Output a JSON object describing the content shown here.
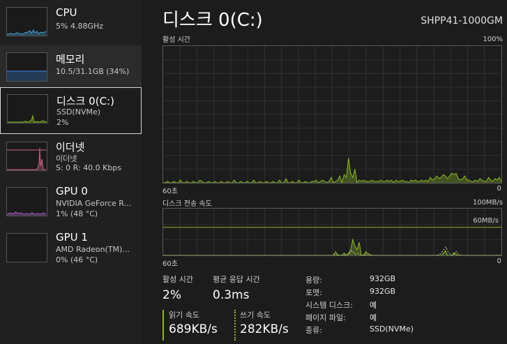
{
  "sidebar": {
    "items": [
      {
        "name": "CPU",
        "line1": "5% 4.88GHz",
        "line2": ""
      },
      {
        "name": "메모리",
        "line1": "10.5/31.1GB (34%)",
        "line2": ""
      },
      {
        "name": "디스크 0(C:)",
        "line1": "SSD(NVMe)",
        "line2": "2%"
      },
      {
        "name": "이더넷",
        "line1": "이더넷",
        "line2": "S: 0 R: 40.0 Kbps"
      },
      {
        "name": "GPU 0",
        "line1": "NVIDIA GeForce R...",
        "line2": "1% (48 °C)"
      },
      {
        "name": "GPU 1",
        "line1": "AMD Radeon(TM)...",
        "line2": "0% (46 °C)"
      }
    ]
  },
  "header": {
    "title": "디스크 0(C:)",
    "model": "SHPP41-1000GM"
  },
  "activity_chart": {
    "label": "활성 시간",
    "max_label": "100%",
    "time_label": "60초",
    "min_label": "0",
    "values": [
      0,
      0,
      1,
      0,
      0,
      1,
      0,
      0,
      2,
      0,
      0,
      1,
      0,
      0,
      1,
      0,
      0,
      2,
      1,
      0,
      0,
      1,
      0,
      0,
      1,
      0,
      0,
      1,
      0,
      0,
      1,
      0,
      0,
      2,
      0,
      0,
      1,
      0,
      0,
      1,
      0,
      0,
      2,
      0,
      0,
      1,
      0,
      0,
      1,
      0,
      0,
      1,
      0,
      0,
      2,
      0,
      0,
      3,
      0,
      0,
      1,
      0,
      0,
      2,
      0,
      0,
      1,
      0,
      0,
      1,
      1,
      2,
      0,
      1,
      2,
      1,
      0,
      1,
      4,
      0,
      1,
      2,
      5,
      0,
      6,
      4,
      18,
      7,
      4,
      10,
      0,
      2,
      1,
      2,
      1,
      1,
      1,
      2,
      1,
      1,
      1,
      2,
      1,
      1,
      2,
      1,
      2,
      0,
      2,
      1,
      1,
      2,
      1,
      1,
      0,
      2,
      1,
      2,
      1,
      1,
      2,
      1,
      2,
      1,
      4,
      2,
      3,
      5,
      3,
      4,
      6,
      5,
      3,
      5,
      7,
      6,
      7,
      3,
      2,
      3,
      5,
      2,
      2,
      1,
      1,
      2,
      1,
      3,
      2,
      1,
      1,
      4,
      2,
      1,
      3,
      2,
      4,
      1
    ]
  },
  "transfer_chart": {
    "label": "디스크 전송 속도",
    "max_label": "100MB/s",
    "ref_label": "60MB/s",
    "ref_value": 60,
    "max_value": 100,
    "time_label": "60초",
    "min_label": "0",
    "read": [
      0,
      0,
      0,
      0,
      0,
      0,
      0,
      0,
      0,
      0,
      0,
      0,
      0,
      0,
      0,
      0,
      0,
      0,
      0,
      0,
      0,
      0,
      0,
      0,
      0,
      0,
      0,
      0,
      0,
      0,
      0,
      0,
      0,
      0,
      0,
      0,
      0,
      0,
      0,
      0,
      0,
      0,
      0,
      0,
      0,
      0,
      0,
      0,
      0,
      0,
      0,
      0,
      0,
      0,
      0,
      0,
      0,
      0,
      0,
      0,
      0,
      0,
      0,
      0,
      0,
      0,
      0,
      0,
      0,
      0,
      0,
      0,
      0,
      0,
      0,
      0,
      0,
      0,
      0,
      0,
      8,
      2,
      0,
      0,
      5,
      0,
      4,
      12,
      34,
      20,
      12,
      28,
      0,
      0,
      8,
      4,
      2,
      0,
      0,
      0,
      0,
      0,
      0,
      0,
      0,
      0,
      0,
      0,
      0,
      0,
      0,
      0,
      0,
      0,
      0,
      0,
      0,
      0,
      0,
      0,
      0,
      0,
      0,
      0,
      0,
      0,
      0,
      0,
      0,
      0,
      4,
      10,
      0,
      0,
      0,
      6,
      2,
      0,
      0,
      0,
      0,
      0,
      0,
      0,
      0,
      0,
      0,
      0,
      0,
      0,
      0,
      0,
      0,
      0,
      0,
      0,
      0,
      0
    ],
    "write": [
      0,
      0,
      0,
      0,
      0,
      0,
      0,
      0,
      0,
      0,
      0,
      0,
      0,
      0,
      0,
      0,
      0,
      0,
      0,
      0,
      0,
      0,
      0,
      0,
      0,
      0,
      0,
      0,
      0,
      0,
      0,
      0,
      0,
      0,
      0,
      0,
      0,
      0,
      0,
      0,
      0,
      0,
      0,
      0,
      0,
      0,
      0,
      0,
      0,
      0,
      0,
      0,
      0,
      0,
      0,
      0,
      0,
      0,
      0,
      0,
      0,
      0,
      0,
      0,
      0,
      0,
      0,
      0,
      0,
      0,
      0,
      0,
      0,
      0,
      0,
      0,
      0,
      0,
      0,
      0,
      2,
      0,
      0,
      0,
      1,
      0,
      2,
      4,
      10,
      6,
      2,
      4,
      0,
      0,
      2,
      0,
      0,
      0,
      0,
      0,
      0,
      0,
      0,
      0,
      0,
      0,
      0,
      0,
      0,
      0,
      0,
      0,
      0,
      0,
      0,
      0,
      0,
      0,
      0,
      0,
      0,
      0,
      0,
      0,
      0,
      0,
      0,
      0,
      0,
      2,
      6,
      12,
      18,
      8,
      2,
      0,
      4,
      8,
      2,
      0,
      0,
      0,
      0,
      0,
      0,
      0,
      0,
      0,
      0,
      0,
      0,
      0,
      0,
      0,
      0,
      0,
      0,
      0,
      0
    ]
  },
  "stats": {
    "active_label": "활성 시간",
    "active_value": "2%",
    "resp_label": "평균 응답 시간",
    "resp_value": "0.3ms",
    "read_label": "읽기 속도",
    "read_value": "689KB/s",
    "write_label": "쓰기 속도",
    "write_value": "282KB/s"
  },
  "props": [
    {
      "k": "용량:",
      "v": "932GB"
    },
    {
      "k": "포맷:",
      "v": "932GB"
    },
    {
      "k": "시스템 디스크:",
      "v": "예"
    },
    {
      "k": "페이지 파일:",
      "v": "예"
    },
    {
      "k": "종류:",
      "v": "SSD(NVMe)"
    }
  ],
  "colors": {
    "disk": "#8bb82a",
    "cpu": "#4aa3d8",
    "mem": "#3a78c8",
    "net": "#d0608c",
    "gpu": "#b060c8"
  }
}
